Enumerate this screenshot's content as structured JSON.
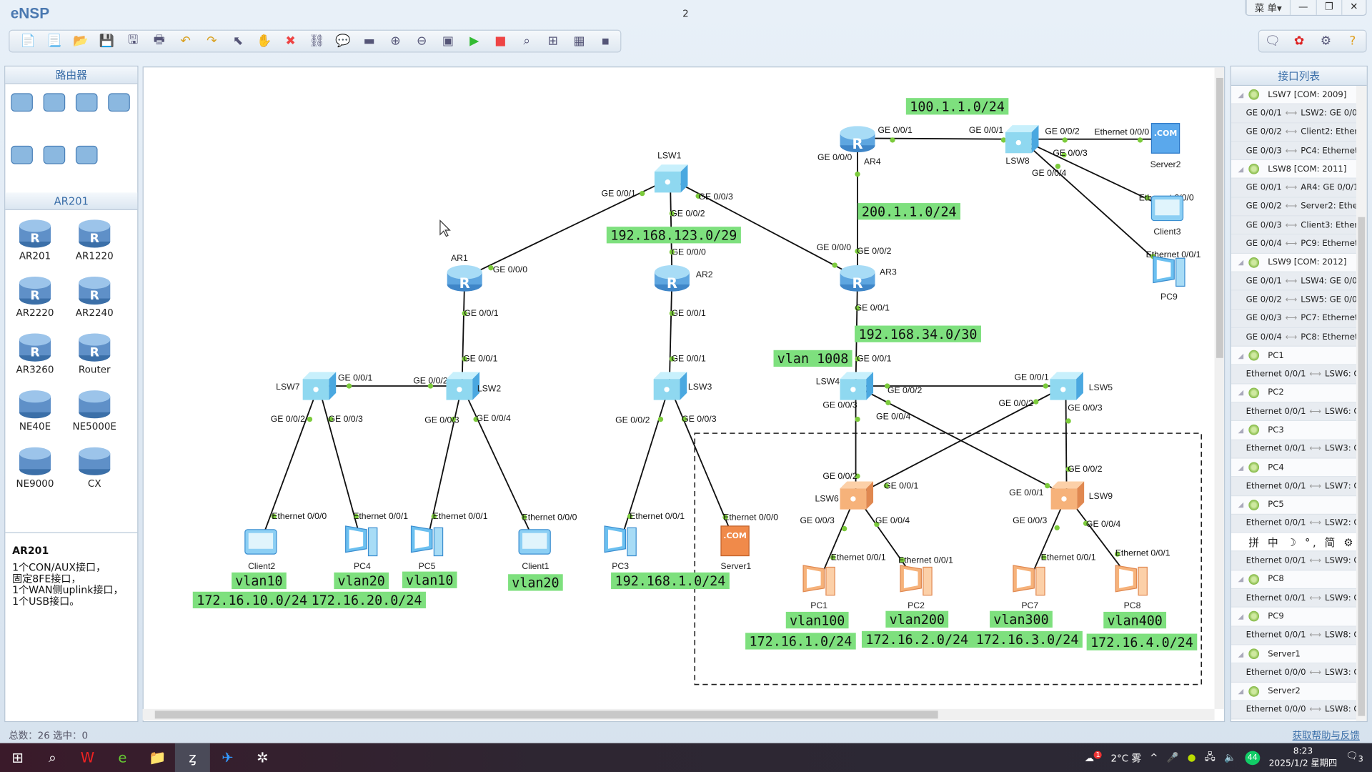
{
  "app": {
    "title": "eNSP",
    "document": "2",
    "menu": "菜 单▾",
    "minimize": "—",
    "restore": "❐",
    "close": "✕"
  },
  "toolbar": {
    "icons": [
      "new-topology-icon",
      "new-blank-icon",
      "open-icon",
      "save-icon",
      "save-as-icon",
      "print-icon",
      "undo-icon",
      "redo-icon",
      "select-icon",
      "pan-hand-icon",
      "delete-icon",
      "delete-link-icon",
      "text-note-icon",
      "palette-icon",
      "zoom-in-icon",
      "zoom-out-icon",
      "fit-icon",
      "start-icon",
      "stop-icon",
      "capture-icon",
      "topology-icon",
      "grid-icon",
      "cli-icon"
    ],
    "right_icons": [
      "chat-icon",
      "huawei-icon",
      "settings-icon",
      "help-icon"
    ]
  },
  "left_panel": {
    "category_title": "路由器",
    "category_icons": [
      "router-category-icon",
      "switch-category-icon",
      "wlan-category-icon",
      "firewall-category-icon",
      "terminal-category-icon",
      "cloud-category-icon",
      "link-category-icon"
    ],
    "device_section_title": "AR201",
    "devices": [
      "AR201",
      "AR1220",
      "AR2220",
      "AR2240",
      "AR3260",
      "Router",
      "NE40E",
      "NE5000E",
      "NE9000",
      "CX"
    ],
    "info": {
      "title": "AR201",
      "lines": [
        "1个CON/AUX接口，",
        "固定8FE接口，",
        "1个WAN侧uplink接口，",
        "1个USB接口。"
      ]
    }
  },
  "topology": {
    "nodes": {
      "LSW1": "LSW1",
      "AR1": "AR1",
      "AR2": "AR2",
      "AR3": "AR3",
      "AR4": "AR4",
      "LSW8": "LSW8",
      "Server2": "Server2",
      "Client3": "Client3",
      "PC9": "PC9",
      "LSW7": "LSW7",
      "LSW2": "LSW2",
      "LSW3": "LSW3",
      "LSW4": "LSW4",
      "LSW5": "LSW5",
      "LSW6": "LSW6",
      "LSW9": "LSW9",
      "Client2": "Client2",
      "PC4": "PC4",
      "PC5": "PC5",
      "Client1": "Client1",
      "PC3": "PC3",
      "Server1": "Server1",
      "PC1": "PC1",
      "PC2": "PC2",
      "PC7": "PC7",
      "PC8": "PC8"
    },
    "links": [
      {
        "a": "LSW1",
        "b": "AR1",
        "a_port": "GE 0/0/1",
        "b_port": "GE 0/0/0"
      },
      {
        "a": "LSW1",
        "b": "AR2",
        "a_port": "GE 0/0/2",
        "b_port": "GE 0/0/0"
      },
      {
        "a": "LSW1",
        "b": "AR3",
        "a_port": "GE 0/0/3",
        "b_port": "GE 0/0/0"
      },
      {
        "a": "AR4",
        "b": "AR3",
        "a_port": "GE 0/0/0",
        "b_port": "GE 0/0/2"
      },
      {
        "a": "AR4",
        "b": "LSW8",
        "a_port": "GE 0/0/1",
        "b_port": "GE 0/0/1"
      },
      {
        "a": "LSW8",
        "b": "Server2",
        "a_port": "GE 0/0/2",
        "b_port": "Ethernet 0/0/0"
      },
      {
        "a": "LSW8",
        "b": "Client3",
        "a_port": "GE 0/0/3",
        "b_port": "Ethernet 0/0/0"
      },
      {
        "a": "LSW8",
        "b": "PC9",
        "a_port": "GE 0/0/4",
        "b_port": "Ethernet 0/0/1"
      },
      {
        "a": "AR1",
        "b": "LSW2",
        "a_port": "GE 0/0/1",
        "b_port": "GE 0/0/1"
      },
      {
        "a": "AR2",
        "b": "LSW3",
        "a_port": "GE 0/0/1",
        "b_port": "GE 0/0/1"
      },
      {
        "a": "AR3",
        "b": "LSW4",
        "a_port": "GE 0/0/1",
        "b_port": "GE 0/0/1"
      },
      {
        "a": "LSW7",
        "b": "LSW2",
        "a_port": "GE 0/0/1",
        "b_port": "GE 0/0/2"
      },
      {
        "a": "LSW7",
        "b": "Client2",
        "a_port": "GE 0/0/2",
        "b_port": "Ethernet 0/0/0"
      },
      {
        "a": "LSW7",
        "b": "PC4",
        "a_port": "GE 0/0/3",
        "b_port": "Ethernet 0/0/1"
      },
      {
        "a": "LSW2",
        "b": "PC5",
        "a_port": "GE 0/0/3",
        "b_port": "Ethernet 0/0/1"
      },
      {
        "a": "LSW2",
        "b": "Client1",
        "a_port": "GE 0/0/4",
        "b_port": "Ethernet 0/0/0"
      },
      {
        "a": "LSW3",
        "b": "PC3",
        "a_port": "GE 0/0/2",
        "b_port": "Ethernet 0/0/1"
      },
      {
        "a": "LSW3",
        "b": "Server1",
        "a_port": "GE 0/0/3",
        "b_port": "Ethernet 0/0/0"
      },
      {
        "a": "LSW4",
        "b": "LSW5",
        "a_port": "GE 0/0/2",
        "b_port": "GE 0/0/1"
      },
      {
        "a": "LSW4",
        "b": "LSW6",
        "a_port": "GE 0/0/3",
        "b_port": "GE 0/0/2"
      },
      {
        "a": "LSW4",
        "b": "LSW9",
        "a_port": "GE 0/0/4",
        "b_port": "GE 0/0/1"
      },
      {
        "a": "LSW5",
        "b": "LSW6",
        "a_port": "GE 0/0/2",
        "b_port": "GE 0/0/1"
      },
      {
        "a": "LSW5",
        "b": "LSW9",
        "a_port": "GE 0/0/3",
        "b_port": "GE 0/0/2"
      },
      {
        "a": "LSW6",
        "b": "PC1",
        "a_port": "GE 0/0/3",
        "b_port": "Ethernet 0/0/1"
      },
      {
        "a": "LSW6",
        "b": "PC2",
        "a_port": "GE 0/0/4",
        "b_port": "Ethernet 0/0/1"
      },
      {
        "a": "LSW9",
        "b": "PC7",
        "a_port": "GE 0/0/3",
        "b_port": "Ethernet 0/0/1"
      },
      {
        "a": "LSW9",
        "b": "PC8",
        "a_port": "GE 0/0/4",
        "b_port": "Ethernet 0/0/1"
      }
    ],
    "annotations": [
      "100.1.1.0/24",
      "200.1.1.0/24",
      "192.168.123.0/29",
      "192.168.34.0/30",
      "vlan 1008",
      "vlan10",
      "172.16.10.0/24",
      "vlan20",
      "172.16.20.0/24",
      "vlan10",
      "vlan20",
      "192.168.1.0/24",
      "vlan100",
      "172.16.1.0/24",
      "vlan200",
      "172.16.2.0/24",
      "vlan300",
      "172.16.3.0/24",
      "vlan400",
      "172.16.4.0/24"
    ],
    "colors": {
      "annotation_bg": "#7ee07e",
      "port_dot": "#7ccb3c",
      "switch_core": "#8fd8f0",
      "switch_access": "#f6b27a"
    }
  },
  "interface_list": {
    "title": "接口列表",
    "rows": [
      {
        "type": "head",
        "text": "LSW7 [COM: 2009]"
      },
      {
        "type": "port",
        "local": "GE 0/0/1",
        "remote": "LSW2: GE 0/0/"
      },
      {
        "type": "port",
        "local": "GE 0/0/2",
        "remote": "Client2: Ethern"
      },
      {
        "type": "port",
        "local": "GE 0/0/3",
        "remote": "PC4: Ethernet"
      },
      {
        "type": "head",
        "text": "LSW8 [COM: 2011]"
      },
      {
        "type": "port",
        "local": "GE 0/0/1",
        "remote": "AR4: GE 0/0/1"
      },
      {
        "type": "port",
        "local": "GE 0/0/2",
        "remote": "Server2: Ethern"
      },
      {
        "type": "port",
        "local": "GE 0/0/3",
        "remote": "Client3: Ethern"
      },
      {
        "type": "port",
        "local": "GE 0/0/4",
        "remote": "PC9: Ethernet"
      },
      {
        "type": "head",
        "text": "LSW9 [COM: 2012]"
      },
      {
        "type": "port",
        "local": "GE 0/0/1",
        "remote": "LSW4: GE 0/0/"
      },
      {
        "type": "port",
        "local": "GE 0/0/2",
        "remote": "LSW5: GE 0/0/"
      },
      {
        "type": "port",
        "local": "GE 0/0/3",
        "remote": "PC7: Ethernet"
      },
      {
        "type": "port",
        "local": "GE 0/0/4",
        "remote": "PC8: Ethernet"
      },
      {
        "type": "head",
        "text": "PC1"
      },
      {
        "type": "port",
        "local": "Ethernet 0/0/1",
        "remote": "LSW6: G"
      },
      {
        "type": "head",
        "text": "PC2"
      },
      {
        "type": "port",
        "local": "Ethernet 0/0/1",
        "remote": "LSW6: G"
      },
      {
        "type": "head",
        "text": "PC3"
      },
      {
        "type": "port",
        "local": "Ethernet 0/0/1",
        "remote": "LSW3: G"
      },
      {
        "type": "head",
        "text": "PC4"
      },
      {
        "type": "port",
        "local": "Ethernet 0/0/1",
        "remote": "LSW7: G"
      },
      {
        "type": "head",
        "text": "PC5"
      },
      {
        "type": "port",
        "local": "Ethernet 0/0/1",
        "remote": "LSW2: G"
      },
      {
        "type": "ime",
        "text": "拼 中 ☽ °, 简 ⚙ ⁝"
      },
      {
        "type": "port",
        "local": "Ethernet 0/0/1",
        "remote": "LSW9: G"
      },
      {
        "type": "head",
        "text": "PC8"
      },
      {
        "type": "port",
        "local": "Ethernet 0/0/1",
        "remote": "LSW9: G"
      },
      {
        "type": "head",
        "text": "PC9"
      },
      {
        "type": "port",
        "local": "Ethernet 0/0/1",
        "remote": "LSW8: G"
      },
      {
        "type": "head",
        "text": "Server1"
      },
      {
        "type": "port",
        "local": "Ethernet 0/0/0",
        "remote": "LSW3: G"
      },
      {
        "type": "head",
        "text": "Server2"
      },
      {
        "type": "port",
        "local": "Ethernet 0/0/0",
        "remote": "LSW8: G"
      }
    ]
  },
  "status": {
    "text": "总数：26  选中：0",
    "help_link": "获取帮助与反馈"
  },
  "taskbar": {
    "apps": [
      "windows-start-icon",
      "search-icon",
      "wps-icon",
      "browser-icon",
      "file-explorer-icon",
      "ensp-icon",
      "feishu-icon",
      "ev-recorder-icon"
    ],
    "weather": "2°C 雾",
    "weather_badge": "1",
    "network_badge": "44",
    "time": "8:23",
    "date": "2025/1/2 星期四",
    "notifications": "3"
  }
}
